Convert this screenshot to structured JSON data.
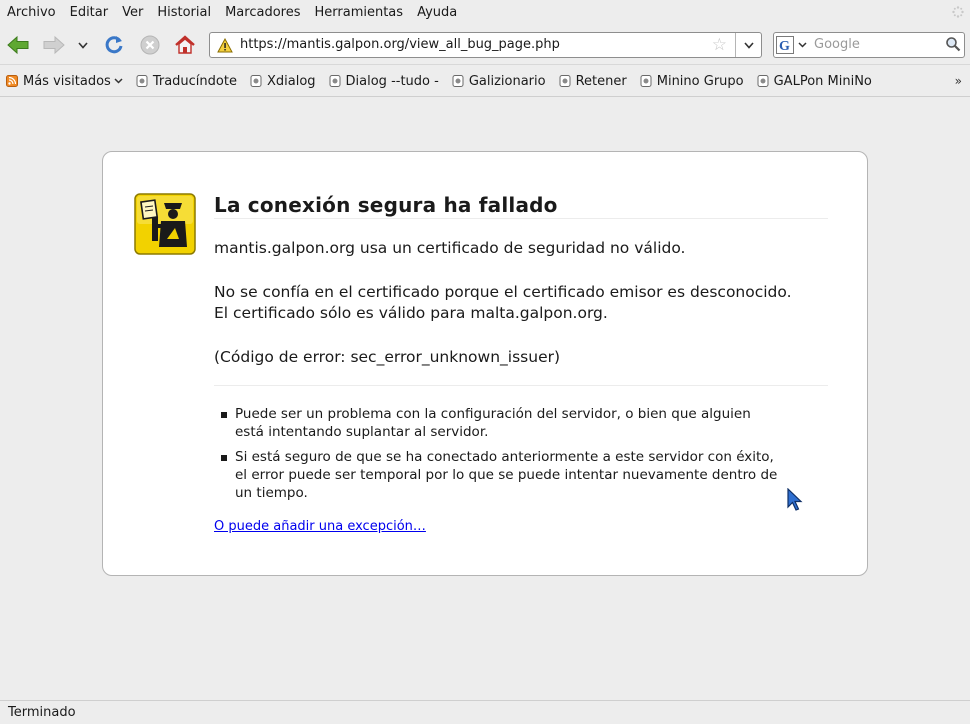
{
  "menubar": {
    "items": [
      {
        "label": "Archivo"
      },
      {
        "label": "Editar"
      },
      {
        "label": "Ver"
      },
      {
        "label": "Historial"
      },
      {
        "label": "Marcadores"
      },
      {
        "label": "Herramientas"
      },
      {
        "label": "Ayuda"
      }
    ]
  },
  "navbar": {
    "url": "https://mantis.galpon.org/view_all_bug_page.php",
    "search_placeholder": "Google"
  },
  "bookmarks": {
    "most_visited": "Más visitados",
    "items": [
      {
        "label": "Traducíndote"
      },
      {
        "label": "Xdialog"
      },
      {
        "label": "Dialog --tudo -"
      },
      {
        "label": "Galizionario"
      },
      {
        "label": "Retener"
      },
      {
        "label": "Minino Grupo"
      },
      {
        "label": "GALPon MiniNo"
      }
    ],
    "more": "»"
  },
  "error": {
    "title": "La conexión segura ha fallado",
    "line1": "mantis.galpon.org usa un certificado de seguridad no válido.",
    "line2a": "No se confía en el certificado porque el certificado emisor es desconocido.",
    "line2b": "El certificado sólo es válido para malta.galpon.org.",
    "code": "(Código de error: sec_error_unknown_issuer)",
    "advice1": "Puede ser un problema con la configuración del servidor, o bien que alguien está intentando suplantar al servidor.",
    "advice2": "Si está seguro de que se ha conectado anteriormente a este servidor con éxito, el error puede ser temporal por lo que se puede intentar nuevamente dentro de un tiempo.",
    "exception_link": "O puede añadir una excepción…"
  },
  "status": {
    "text": "Terminado"
  },
  "colors": {
    "chrome_bg": "#ededed",
    "link": "#0000ee",
    "icon_yellow": "#f5d800"
  }
}
